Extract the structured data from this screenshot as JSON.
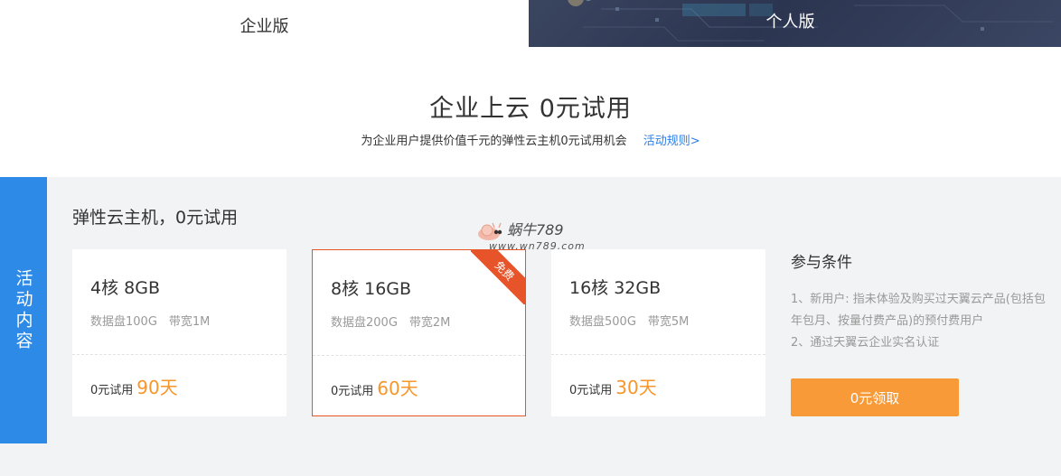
{
  "tabs": [
    {
      "label": "企业版",
      "active": true
    },
    {
      "label": "个人版",
      "active": false
    }
  ],
  "hero": {
    "title": "企业上云  0元试用",
    "subtitle": "为企业用户提供价值千元的弹性云主机0元试用机会",
    "rules_link": "活动规则>"
  },
  "activity": {
    "side_label": "活动内容",
    "section_title": "弹性云主机，0元试用",
    "cards": [
      {
        "spec": "4核 8GB",
        "detail": "数据盘100G　带宽1M",
        "trial_prefix": "0元试用",
        "days": "90天",
        "selected": false
      },
      {
        "spec": "8核 16GB",
        "detail": "数据盘200G　带宽2M",
        "trial_prefix": "0元试用",
        "days": "60天",
        "selected": true,
        "ribbon": "免费"
      },
      {
        "spec": "16核 32GB",
        "detail": "数据盘500G　带宽5M",
        "trial_prefix": "0元试用",
        "days": "30天",
        "selected": false
      }
    ],
    "conditions": {
      "title": "参与条件",
      "items": [
        "1、新用户: 指未体验及购买过天翼云产品(包括包年包月、按量付费产品)的预付费用户",
        "2、通过天翼云企业实名认证"
      ]
    },
    "claim_button": "0元领取"
  },
  "watermark": {
    "line1": "蜗牛789",
    "line2": "www.wn789.com"
  },
  "colors": {
    "accent_blue": "#2d8ae6",
    "accent_orange": "#f7962a",
    "selected_border": "#e8542a",
    "button_orange": "#f89a37"
  }
}
